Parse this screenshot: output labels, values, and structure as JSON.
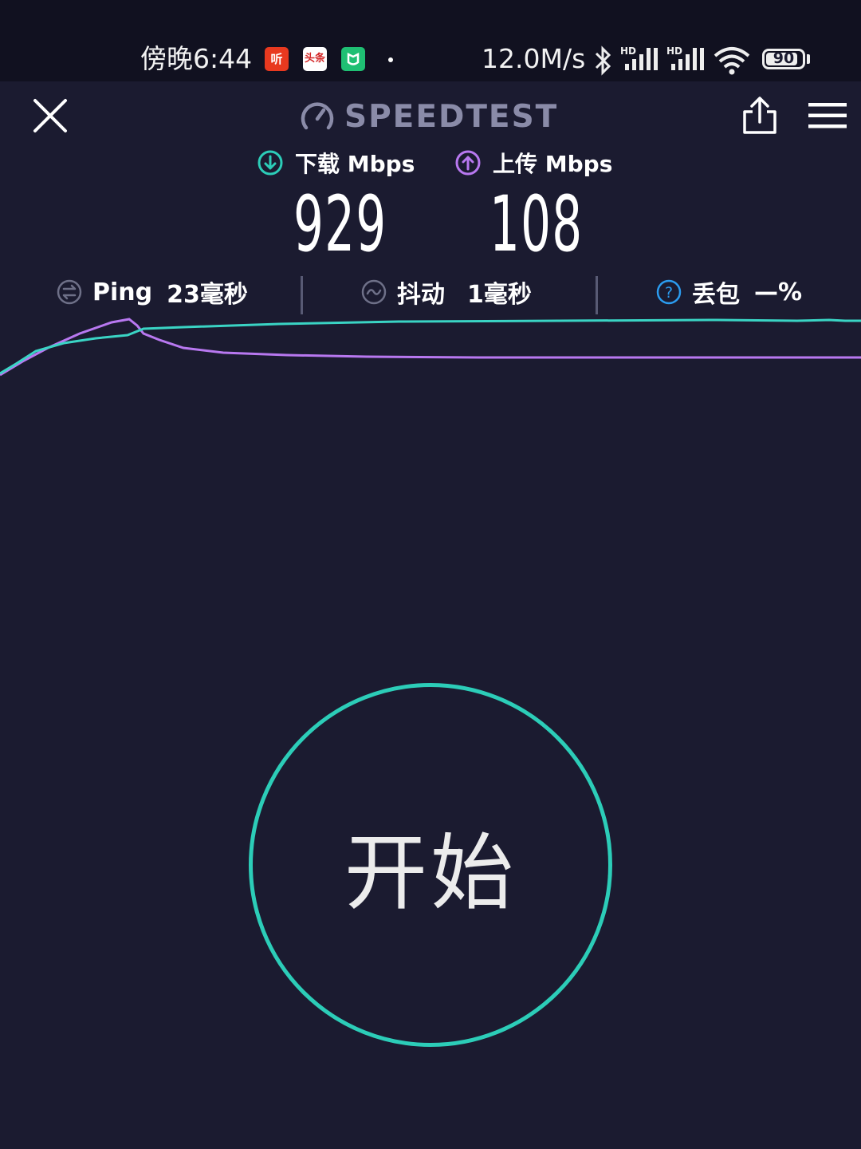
{
  "status_bar": {
    "time": "傍晚6:44",
    "apps": [
      {
        "name": "听",
        "color": "#e8391f"
      },
      {
        "name": "头条",
        "color": "#ffffff"
      },
      {
        "name": "米家",
        "color": "#1fbf73"
      }
    ],
    "net_speed": "12.0M/s",
    "signal_badge": "HD",
    "battery": "90",
    "battery_level": 0.9
  },
  "header": {
    "logo_text": "SPEEDTEST"
  },
  "results": {
    "download": {
      "label": "下载 Mbps",
      "value": "929",
      "color": "#2ccdb8"
    },
    "upload": {
      "label": "上传 Mbps",
      "value": "108",
      "color": "#b878f0"
    }
  },
  "stats": {
    "ping": {
      "label": "Ping",
      "value": "23毫秒"
    },
    "jitter": {
      "label": "抖动",
      "value": "1毫秒"
    },
    "loss": {
      "label": "丢包",
      "value": "—%"
    }
  },
  "start_button": {
    "label": "开始",
    "color": "#2ccdb8"
  }
}
